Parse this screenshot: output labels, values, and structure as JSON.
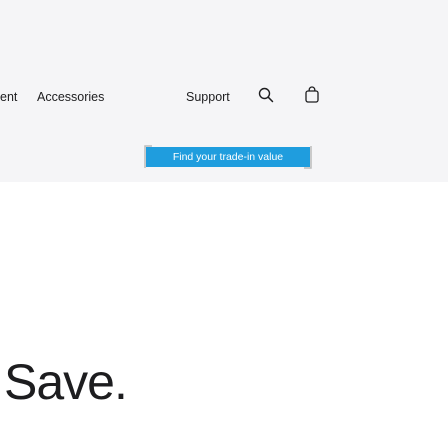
{
  "nav": {
    "items": [
      {
        "label": "ent"
      },
      {
        "label": "Accessories"
      },
      {
        "label": "Support"
      }
    ],
    "search_icon": "search-icon",
    "bag_icon": "shopping-bag-icon"
  },
  "promo": {
    "trade_in_label": "Find your trade-in value",
    "accent_color": "#1f9dde"
  },
  "hero": {
    "headline": "Save."
  }
}
